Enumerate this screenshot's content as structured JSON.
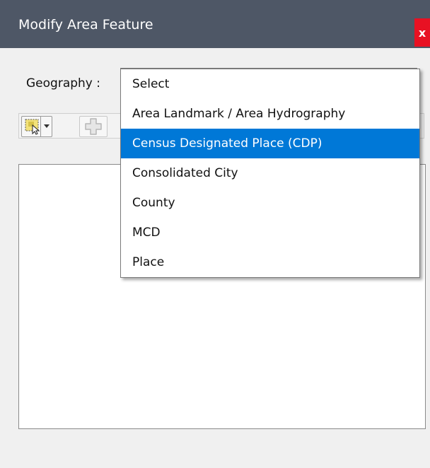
{
  "window": {
    "title": "Modify Area Feature",
    "close_label": "x"
  },
  "form": {
    "geography_label": "Geography :",
    "dropdown_options": [
      "Select",
      "Area Landmark / Area Hydrography",
      "Census Designated Place (CDP)",
      "Consolidated City",
      "County",
      "MCD",
      "Place"
    ],
    "highlighted_option": "Census Designated Place (CDP)"
  },
  "colors": {
    "titlebar": "#4e5766",
    "close_button": "#e81123",
    "highlight": "#0078d7"
  },
  "icons": {
    "select_tool": "select-feature-icon",
    "add": "add-icon"
  }
}
